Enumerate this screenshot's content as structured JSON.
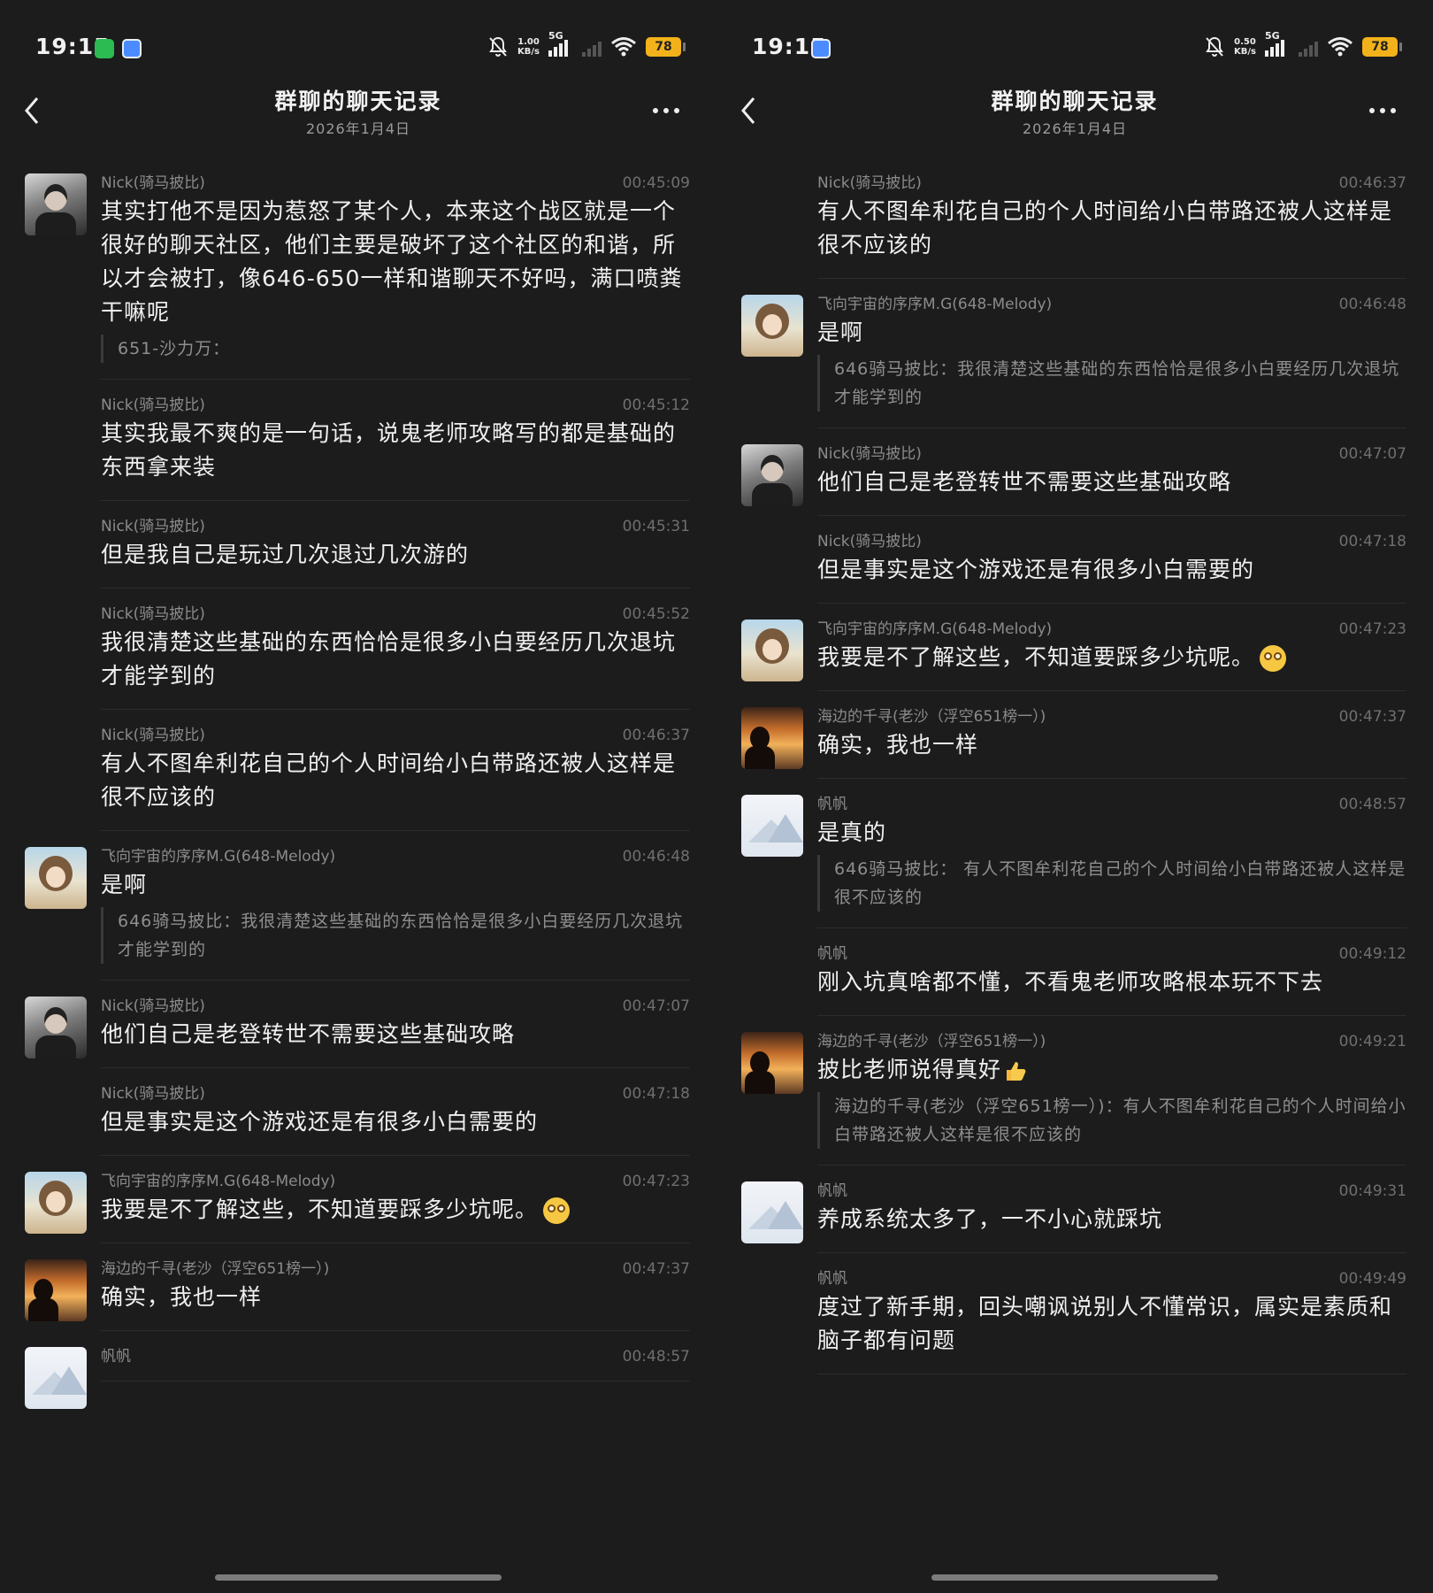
{
  "status_bar": {
    "time": "19:15",
    "left_speed": "1.00\nKB/s",
    "right_speed": "0.50\nKB/s",
    "net": "5G",
    "battery": "78"
  },
  "header": {
    "title": "群聊的聊天记录",
    "date": "2026年1月4日"
  },
  "left_messages": [
    {
      "sender": "Nick(骑马披比)",
      "time": "00:45:09",
      "avatar": "nick",
      "text": "其实打他不是因为惹怒了某个人，本来这个战区就是一个很好的聊天社区，他们主要是破坏了这个社区的和谐，所以才会被打，像646-650一样和谐聊天不好吗，满口喷粪干嘛呢",
      "quote": "651-沙力万："
    },
    {
      "sender": "Nick(骑马披比)",
      "time": "00:45:12",
      "avatar": "",
      "text": "其实我最不爽的是一句话，说鬼老师攻略写的都是基础的东西拿来装"
    },
    {
      "sender": "Nick(骑马披比)",
      "time": "00:45:31",
      "avatar": "",
      "text": "但是我自己是玩过几次退过几次游的"
    },
    {
      "sender": "Nick(骑马披比)",
      "time": "00:45:52",
      "avatar": "",
      "text": "我很清楚这些基础的东西恰恰是很多小白要经历几次退坑才能学到的"
    },
    {
      "sender": "Nick(骑马披比)",
      "time": "00:46:37",
      "avatar": "",
      "text": "有人不图牟利花自己的个人时间给小白带路还被人这样是很不应该的"
    },
    {
      "sender": "飞向宇宙的序序M.G(648-Melody)",
      "time": "00:46:48",
      "avatar": "melody",
      "text": "是啊",
      "quote": "646骑马披比：我很清楚这些基础的东西恰恰是很多小白要经历几次退坑才能学到的"
    },
    {
      "sender": "Nick(骑马披比)",
      "time": "00:47:07",
      "avatar": "nick",
      "text": "他们自己是老登转世不需要这些基础攻略"
    },
    {
      "sender": "Nick(骑马披比)",
      "time": "00:47:18",
      "avatar": "",
      "text": "但是事实是这个游戏还是有很多小白需要的"
    },
    {
      "sender": "飞向宇宙的序序M.G(648-Melody)",
      "time": "00:47:23",
      "avatar": "melody",
      "text": "我要是不了解这些，不知道要踩多少坑呢。",
      "emoji": "dizzy-face-emoji"
    },
    {
      "sender": "海边的千寻(老沙（浮空651榜一）)",
      "time": "00:47:37",
      "avatar": "sea",
      "text": "确实，我也一样"
    },
    {
      "sender": "帆帆",
      "time": "00:48:57",
      "avatar": "fan",
      "text": ""
    }
  ],
  "right_messages": [
    {
      "sender": "Nick(骑马披比)",
      "time": "00:46:37",
      "avatar": "",
      "text": "有人不图牟利花自己的个人时间给小白带路还被人这样是很不应该的"
    },
    {
      "sender": "飞向宇宙的序序M.G(648-Melody)",
      "time": "00:46:48",
      "avatar": "melody",
      "text": "是啊",
      "quote": "646骑马披比：我很清楚这些基础的东西恰恰是很多小白要经历几次退坑才能学到的"
    },
    {
      "sender": "Nick(骑马披比)",
      "time": "00:47:07",
      "avatar": "nick",
      "text": "他们自己是老登转世不需要这些基础攻略"
    },
    {
      "sender": "Nick(骑马披比)",
      "time": "00:47:18",
      "avatar": "",
      "text": "但是事实是这个游戏还是有很多小白需要的"
    },
    {
      "sender": "飞向宇宙的序序M.G(648-Melody)",
      "time": "00:47:23",
      "avatar": "melody",
      "text": "我要是不了解这些，不知道要踩多少坑呢。",
      "emoji": "dizzy-face-emoji"
    },
    {
      "sender": "海边的千寻(老沙（浮空651榜一）)",
      "time": "00:47:37",
      "avatar": "sea",
      "text": "确实，我也一样"
    },
    {
      "sender": "帆帆",
      "time": "00:48:57",
      "avatar": "fan",
      "text": "是真的",
      "quote": "646骑马披比： 有人不图牟利花自己的个人时间给小白带路还被人这样是很不应该的"
    },
    {
      "sender": "帆帆",
      "time": "00:49:12",
      "avatar": "",
      "text": "刚入坑真啥都不懂，不看鬼老师攻略根本玩不下去"
    },
    {
      "sender": "海边的千寻(老沙（浮空651榜一）)",
      "time": "00:49:21",
      "avatar": "sea",
      "text": "披比老师说得真好",
      "thumb": "thumbs-up-emoji",
      "quote": "海边的千寻(老沙（浮空651榜一）)：有人不图牟利花自己的个人时间给小白带路还被人这样是很不应该的"
    },
    {
      "sender": "帆帆",
      "time": "00:49:31",
      "avatar": "fan",
      "text": "养成系统太多了，一不小心就踩坑"
    },
    {
      "sender": "帆帆",
      "time": "00:49:49",
      "avatar": "",
      "text": "度过了新手期，回头嘲讽说别人不懂常识，属实是素质和脑子都有问题"
    }
  ]
}
